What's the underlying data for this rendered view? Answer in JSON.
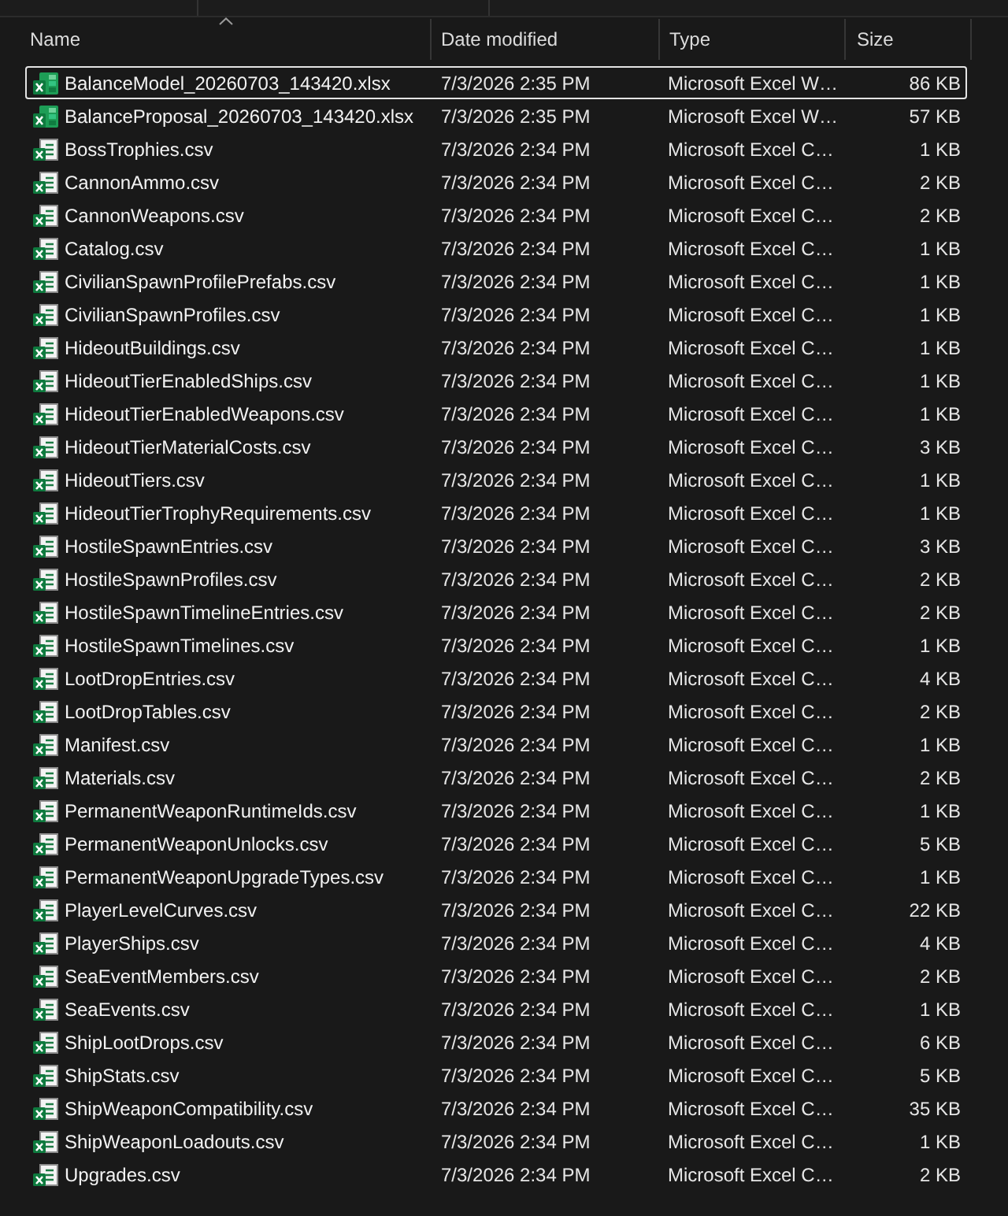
{
  "columns": [
    {
      "label": "Name",
      "sorted": true
    },
    {
      "label": "Date modified",
      "sorted": false
    },
    {
      "label": "Type",
      "sorted": false
    },
    {
      "label": "Size",
      "sorted": false
    }
  ],
  "files": [
    {
      "name": "BalanceModel_20260703_143420.xlsx",
      "kind": "xlsx",
      "focused": true,
      "date_modified": "7/3/2026 2:35 PM",
      "type": "Microsoft Excel W…",
      "size": "86 KB"
    },
    {
      "name": "BalanceProposal_20260703_143420.xlsx",
      "kind": "xlsx",
      "focused": false,
      "date_modified": "7/3/2026 2:35 PM",
      "type": "Microsoft Excel W…",
      "size": "57 KB"
    },
    {
      "name": "BossTrophies.csv",
      "kind": "csv",
      "focused": false,
      "date_modified": "7/3/2026 2:34 PM",
      "type": "Microsoft Excel C…",
      "size": "1 KB"
    },
    {
      "name": "CannonAmmo.csv",
      "kind": "csv",
      "focused": false,
      "date_modified": "7/3/2026 2:34 PM",
      "type": "Microsoft Excel C…",
      "size": "2 KB"
    },
    {
      "name": "CannonWeapons.csv",
      "kind": "csv",
      "focused": false,
      "date_modified": "7/3/2026 2:34 PM",
      "type": "Microsoft Excel C…",
      "size": "2 KB"
    },
    {
      "name": "Catalog.csv",
      "kind": "csv",
      "focused": false,
      "date_modified": "7/3/2026 2:34 PM",
      "type": "Microsoft Excel C…",
      "size": "1 KB"
    },
    {
      "name": "CivilianSpawnProfilePrefabs.csv",
      "kind": "csv",
      "focused": false,
      "date_modified": "7/3/2026 2:34 PM",
      "type": "Microsoft Excel C…",
      "size": "1 KB"
    },
    {
      "name": "CivilianSpawnProfiles.csv",
      "kind": "csv",
      "focused": false,
      "date_modified": "7/3/2026 2:34 PM",
      "type": "Microsoft Excel C…",
      "size": "1 KB"
    },
    {
      "name": "HideoutBuildings.csv",
      "kind": "csv",
      "focused": false,
      "date_modified": "7/3/2026 2:34 PM",
      "type": "Microsoft Excel C…",
      "size": "1 KB"
    },
    {
      "name": "HideoutTierEnabledShips.csv",
      "kind": "csv",
      "focused": false,
      "date_modified": "7/3/2026 2:34 PM",
      "type": "Microsoft Excel C…",
      "size": "1 KB"
    },
    {
      "name": "HideoutTierEnabledWeapons.csv",
      "kind": "csv",
      "focused": false,
      "date_modified": "7/3/2026 2:34 PM",
      "type": "Microsoft Excel C…",
      "size": "1 KB"
    },
    {
      "name": "HideoutTierMaterialCosts.csv",
      "kind": "csv",
      "focused": false,
      "date_modified": "7/3/2026 2:34 PM",
      "type": "Microsoft Excel C…",
      "size": "3 KB"
    },
    {
      "name": "HideoutTiers.csv",
      "kind": "csv",
      "focused": false,
      "date_modified": "7/3/2026 2:34 PM",
      "type": "Microsoft Excel C…",
      "size": "1 KB"
    },
    {
      "name": "HideoutTierTrophyRequirements.csv",
      "kind": "csv",
      "focused": false,
      "date_modified": "7/3/2026 2:34 PM",
      "type": "Microsoft Excel C…",
      "size": "1 KB"
    },
    {
      "name": "HostileSpawnEntries.csv",
      "kind": "csv",
      "focused": false,
      "date_modified": "7/3/2026 2:34 PM",
      "type": "Microsoft Excel C…",
      "size": "3 KB"
    },
    {
      "name": "HostileSpawnProfiles.csv",
      "kind": "csv",
      "focused": false,
      "date_modified": "7/3/2026 2:34 PM",
      "type": "Microsoft Excel C…",
      "size": "2 KB"
    },
    {
      "name": "HostileSpawnTimelineEntries.csv",
      "kind": "csv",
      "focused": false,
      "date_modified": "7/3/2026 2:34 PM",
      "type": "Microsoft Excel C…",
      "size": "2 KB"
    },
    {
      "name": "HostileSpawnTimelines.csv",
      "kind": "csv",
      "focused": false,
      "date_modified": "7/3/2026 2:34 PM",
      "type": "Microsoft Excel C…",
      "size": "1 KB"
    },
    {
      "name": "LootDropEntries.csv",
      "kind": "csv",
      "focused": false,
      "date_modified": "7/3/2026 2:34 PM",
      "type": "Microsoft Excel C…",
      "size": "4 KB"
    },
    {
      "name": "LootDropTables.csv",
      "kind": "csv",
      "focused": false,
      "date_modified": "7/3/2026 2:34 PM",
      "type": "Microsoft Excel C…",
      "size": "2 KB"
    },
    {
      "name": "Manifest.csv",
      "kind": "csv",
      "focused": false,
      "date_modified": "7/3/2026 2:34 PM",
      "type": "Microsoft Excel C…",
      "size": "1 KB"
    },
    {
      "name": "Materials.csv",
      "kind": "csv",
      "focused": false,
      "date_modified": "7/3/2026 2:34 PM",
      "type": "Microsoft Excel C…",
      "size": "2 KB"
    },
    {
      "name": "PermanentWeaponRuntimeIds.csv",
      "kind": "csv",
      "focused": false,
      "date_modified": "7/3/2026 2:34 PM",
      "type": "Microsoft Excel C…",
      "size": "1 KB"
    },
    {
      "name": "PermanentWeaponUnlocks.csv",
      "kind": "csv",
      "focused": false,
      "date_modified": "7/3/2026 2:34 PM",
      "type": "Microsoft Excel C…",
      "size": "5 KB"
    },
    {
      "name": "PermanentWeaponUpgradeTypes.csv",
      "kind": "csv",
      "focused": false,
      "date_modified": "7/3/2026 2:34 PM",
      "type": "Microsoft Excel C…",
      "size": "1 KB"
    },
    {
      "name": "PlayerLevelCurves.csv",
      "kind": "csv",
      "focused": false,
      "date_modified": "7/3/2026 2:34 PM",
      "type": "Microsoft Excel C…",
      "size": "22 KB"
    },
    {
      "name": "PlayerShips.csv",
      "kind": "csv",
      "focused": false,
      "date_modified": "7/3/2026 2:34 PM",
      "type": "Microsoft Excel C…",
      "size": "4 KB"
    },
    {
      "name": "SeaEventMembers.csv",
      "kind": "csv",
      "focused": false,
      "date_modified": "7/3/2026 2:34 PM",
      "type": "Microsoft Excel C…",
      "size": "2 KB"
    },
    {
      "name": "SeaEvents.csv",
      "kind": "csv",
      "focused": false,
      "date_modified": "7/3/2026 2:34 PM",
      "type": "Microsoft Excel C…",
      "size": "1 KB"
    },
    {
      "name": "ShipLootDrops.csv",
      "kind": "csv",
      "focused": false,
      "date_modified": "7/3/2026 2:34 PM",
      "type": "Microsoft Excel C…",
      "size": "6 KB"
    },
    {
      "name": "ShipStats.csv",
      "kind": "csv",
      "focused": false,
      "date_modified": "7/3/2026 2:34 PM",
      "type": "Microsoft Excel C…",
      "size": "5 KB"
    },
    {
      "name": "ShipWeaponCompatibility.csv",
      "kind": "csv",
      "focused": false,
      "date_modified": "7/3/2026 2:34 PM",
      "type": "Microsoft Excel C…",
      "size": "35 KB"
    },
    {
      "name": "ShipWeaponLoadouts.csv",
      "kind": "csv",
      "focused": false,
      "date_modified": "7/3/2026 2:34 PM",
      "type": "Microsoft Excel C…",
      "size": "1 KB"
    },
    {
      "name": "Upgrades.csv",
      "kind": "csv",
      "focused": false,
      "date_modified": "7/3/2026 2:34 PM",
      "type": "Microsoft Excel C…",
      "size": "2 KB"
    }
  ]
}
